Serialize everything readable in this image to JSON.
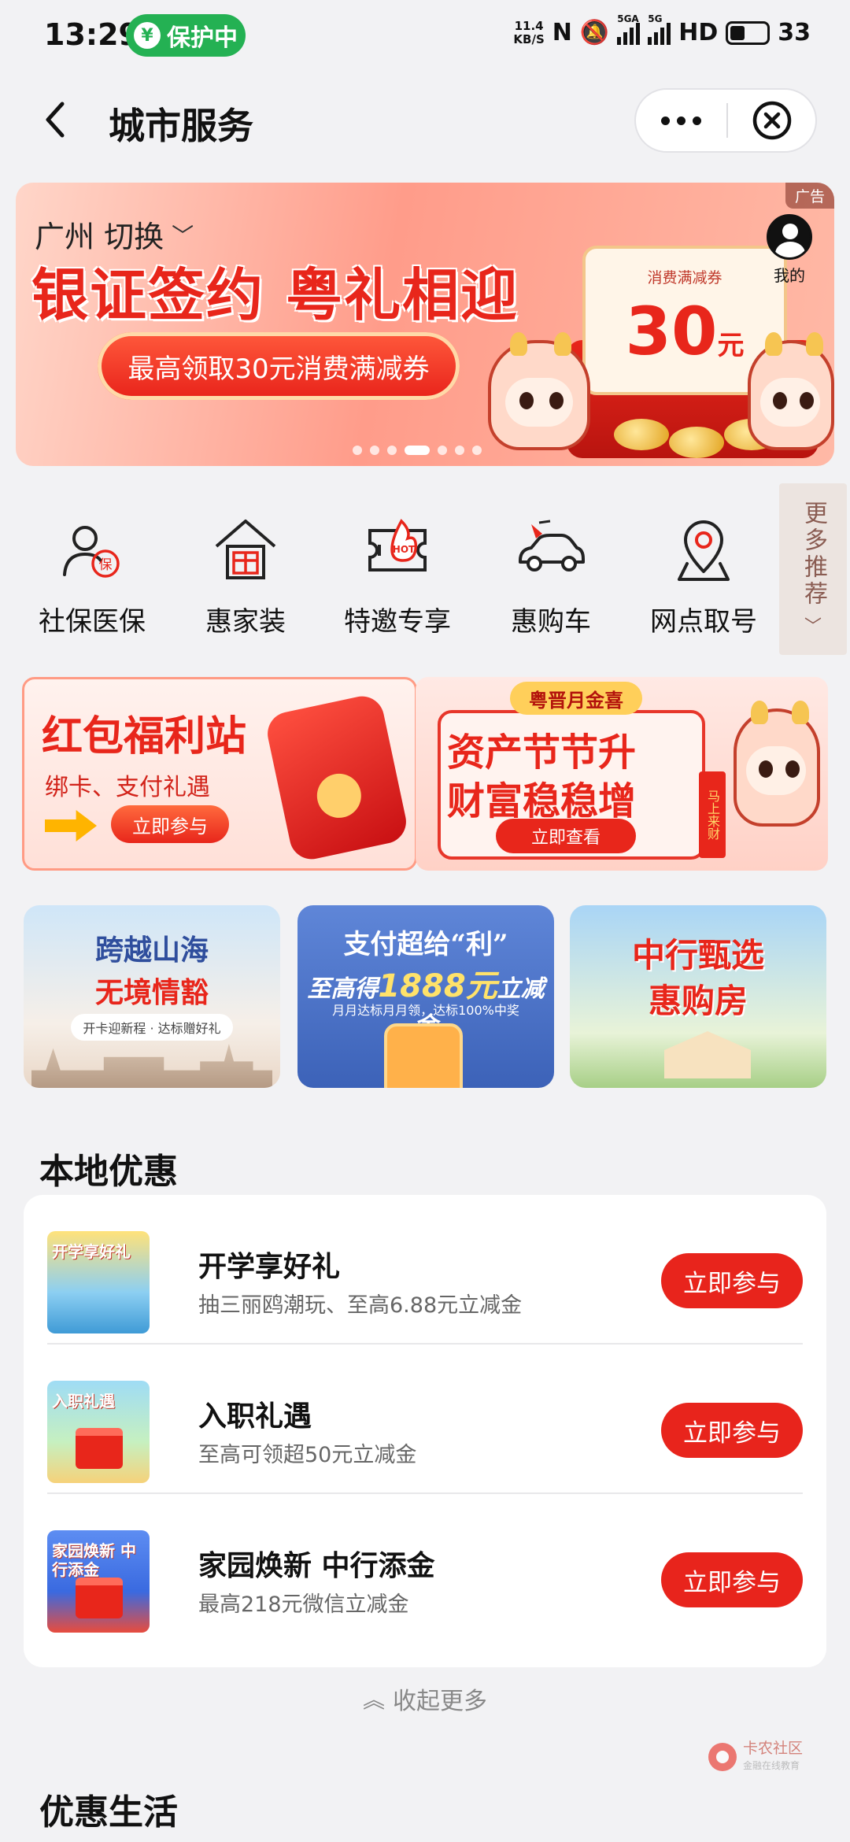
{
  "status_bar": {
    "time": "13:29",
    "protect_label": "保护中",
    "protect_icon": "¥",
    "net_speed_value": "11.4",
    "net_speed_unit": "KB/S",
    "sig1_tag": "5GA",
    "sig2_tag": "5G",
    "hd_label": "HD",
    "battery": "33"
  },
  "nav": {
    "title": "城市服务"
  },
  "banner": {
    "ad_tag": "广告",
    "city": "广州 切换",
    "me_label": "我的",
    "title": "银证签约 粤礼相迎",
    "pill": "最高领取30元消费满减券",
    "coupon_label": "消费满减券",
    "coupon_value": "30",
    "coupon_unit": "元"
  },
  "menu": {
    "items": [
      {
        "label": "社保医保",
        "icon": "social-security-icon"
      },
      {
        "label": "惠家装",
        "icon": "home-gift-icon"
      },
      {
        "label": "特邀专享",
        "icon": "hot-ticket-icon"
      },
      {
        "label": "惠购车",
        "icon": "car-icon"
      },
      {
        "label": "网点取号",
        "icon": "location-pin-icon"
      }
    ],
    "more": "更多推荐"
  },
  "promos": {
    "a_title": "红包福利站",
    "a_sub": "绑卡、支付礼遇",
    "a_btn": "立即参与",
    "b_tag": "粤晋月金喜",
    "b_line1": "资产节节升",
    "b_line2": "财富稳稳增",
    "b_btn": "立即查看",
    "b_side": "马上来财"
  },
  "tiles": {
    "a_line1": "跨越山海",
    "a_line2": "无境情豁",
    "a_sub": "开卡迎新程 · 达标赠好礼",
    "b_line1": "支付超给“利”",
    "b_line2_pre": "至高得",
    "b_line2_num": "1888元",
    "b_line2_post": "立减金",
    "b_sub": "月月达标月月领，达标100%中奖",
    "c_line1": "中行甄选",
    "c_line2": "惠购房"
  },
  "local": {
    "section_title": "本地优惠",
    "offers": [
      {
        "title": "开学享好礼",
        "desc": "抽三丽鸥潮玩、至高6.88元立减金",
        "button": "立即参与",
        "thumb_text": "开学享好礼"
      },
      {
        "title": "入职礼遇",
        "desc": "至高可领超50元立减金",
        "button": "立即参与",
        "thumb_text": "入职礼遇"
      },
      {
        "title": "家园焕新 中行添金",
        "desc": "最高218元微信立减金",
        "button": "立即参与",
        "thumb_text": "家园焕新 中行添金"
      }
    ],
    "collapse": "收起更多"
  },
  "life": {
    "section_title": "优惠生活"
  },
  "watermark": {
    "name": "卡农社区",
    "tagline": "金融在线教育"
  },
  "colors": {
    "accent_red": "#e8241c",
    "shield_green": "#24b153",
    "background": "#f2f2f4"
  }
}
